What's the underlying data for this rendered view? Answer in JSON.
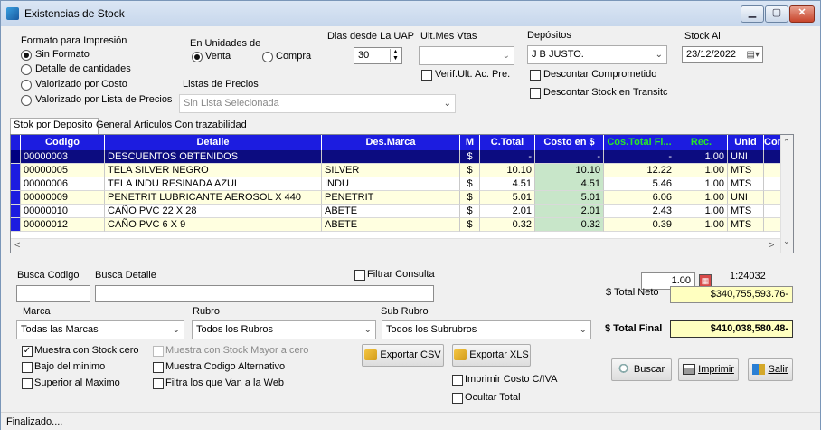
{
  "window": {
    "title": "Existencias de Stock",
    "btn_min": "▁",
    "btn_max": "▢",
    "btn_close": "✕"
  },
  "print_format": {
    "label": "Formato para Impresión",
    "options": [
      "Sin Formato",
      "Detalle de cantidades",
      "Valorizado por Costo",
      "Valorizado por Lista de Precios"
    ],
    "selected": "Sin Formato"
  },
  "units": {
    "label": "En Unidades de",
    "venta": "Venta",
    "compra": "Compra",
    "selected": "Venta"
  },
  "price_lists": {
    "label": "Listas de Precios",
    "value": "Sin Lista Selecionada"
  },
  "dias_uap": {
    "label": "Dias desde La UAP",
    "value": "30"
  },
  "ult_mes": {
    "label": "Ult.Mes Vtas",
    "value": "",
    "verif_label": "Verif.Ult. Ac. Pre."
  },
  "depositos": {
    "label": "Depósitos",
    "value": "J B JUSTO.",
    "descontar_comprometido": "Descontar Comprometido",
    "descontar_transito": "Descontar Stock en Transitc"
  },
  "stock_al": {
    "label": "Stock Al",
    "value": "23/12/2022"
  },
  "tabs": [
    "Stok por Deposito",
    "General",
    "Articulos Con trazabilidad"
  ],
  "grid": {
    "columns": [
      "Codigo",
      "Detalle",
      "Des.Marca",
      "M",
      "C.Total",
      "Costo en $",
      "Cos.Total Fi...",
      "Rec.",
      "Unid",
      "Compr"
    ],
    "rows": [
      [
        "00000003",
        "DESCUENTOS OBTENIDOS",
        "",
        "$",
        "-",
        "-",
        "-",
        "1.00",
        "UNI",
        ""
      ],
      [
        "00000005",
        "TELA SILVER NEGRO",
        "SILVER",
        "$",
        "10.10",
        "10.10",
        "12.22",
        "1.00",
        "MTS",
        ""
      ],
      [
        "00000006",
        "TELA INDU RESINADA AZUL",
        "INDU",
        "$",
        "4.51",
        "4.51",
        "5.46",
        "1.00",
        "MTS",
        ""
      ],
      [
        "00000009",
        "PENETRIT LUBRICANTE AEROSOL X 440",
        "PENETRIT",
        "$",
        "5.01",
        "5.01",
        "6.06",
        "1.00",
        "UNI",
        ""
      ],
      [
        "00000010",
        "CAÑO PVC 22 X 28",
        "ABETE",
        "$",
        "2.01",
        "2.01",
        "2.43",
        "1.00",
        "MTS",
        ""
      ],
      [
        "00000012",
        "CAÑO PVC 6 X 9",
        "ABETE",
        "$",
        "0.32",
        "0.32",
        "0.39",
        "1.00",
        "MTS",
        ""
      ]
    ]
  },
  "search": {
    "codigo_label": "Busca Codigo",
    "detalle_label": "Busca Detalle",
    "filtrar_label": "Filtrar Consulta"
  },
  "filters": {
    "marca_label": "Marca",
    "marca_value": "Todas las Marcas",
    "rubro_label": "Rubro",
    "rubro_value": "Todos los Rubros",
    "subrubro_label": "Sub Rubro",
    "subrubro_value": "Todos los Subrubros"
  },
  "checks": {
    "stock_cero": "Muestra con Stock cero",
    "bajo_minimo": "Bajo del minimo",
    "superior_maximo": "Superior al Maximo",
    "stock_mayor_cero": "Muestra con Stock Mayor a cero",
    "codigo_alternativo": "Muestra Codigo Alternativo",
    "filtra_web": "Filtra los que Van a la Web",
    "imprimir_costo": "Imprimir Costo C/IVA",
    "ocultar_total": "Ocultar Total"
  },
  "actions": {
    "export_csv": "Exportar CSV",
    "export_xls": "Exportar XLS",
    "buscar": "Buscar",
    "imprimir": "Imprimir",
    "salir": "Salir"
  },
  "totals": {
    "ratio_value": "1.00",
    "ratio_text": "1:24032",
    "neto_label": "$ Total Neto",
    "neto_value": "$340,755,593.76-",
    "final_label": "$ Total Final",
    "final_value": "$410,038,580.48-"
  },
  "status": {
    "text": "Finalizado...."
  },
  "colors": {
    "grid_header": "#1c1ce0",
    "row_selected": "#0c0c80",
    "row_alt": "#ffffe0",
    "cost_highlight": "#c8e6c9",
    "total_bg": "#ffffc0"
  }
}
